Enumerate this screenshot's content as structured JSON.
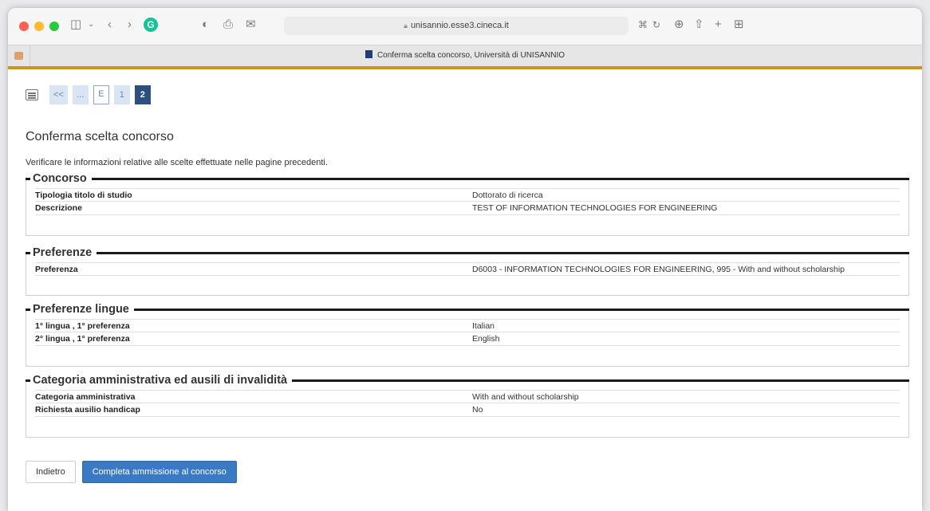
{
  "browser": {
    "url": "unisannio.esse3.cineca.it",
    "tab_title": "Conferma scelta concorso, Università di UNISANNIO",
    "grammarly_letter": "G"
  },
  "steps": {
    "items": [
      "<<",
      "...",
      "E",
      "1",
      "2"
    ]
  },
  "page": {
    "title": "Conferma scelta concorso",
    "intro": "Verificare le informazioni relative alle scelte effettuate nelle pagine precedenti."
  },
  "sections": [
    {
      "title": "Concorso",
      "rows": [
        {
          "label": "Tipologia titolo di studio",
          "value": "Dottorato di ricerca"
        },
        {
          "label": "Descrizione",
          "value": "TEST OF INFORMATION TECHNOLOGIES FOR ENGINEERING"
        }
      ]
    },
    {
      "title": "Preferenze",
      "rows": [
        {
          "label": "Preferenza",
          "value": "D6003 - INFORMATION TECHNOLOGIES FOR ENGINEERING, 995 - With and without scholarship"
        }
      ]
    },
    {
      "title": "Preferenze lingue",
      "rows": [
        {
          "label": "1° lingua , 1° preferenza",
          "value": "Italian"
        },
        {
          "label": "2° lingua , 1° preferenza",
          "value": "English"
        }
      ]
    },
    {
      "title": "Categoria amministrativa ed ausili di invalidità",
      "rows": [
        {
          "label": "Categoria amministrativa",
          "value": "With and without scholarship"
        },
        {
          "label": "Richiesta ausilio handicap",
          "value": "No"
        }
      ]
    }
  ],
  "actions": {
    "back_label": "Indietro",
    "submit_label": "Completa ammissione al concorso"
  },
  "colors": {
    "accent": "#c9961f",
    "primary": "#3a79c4",
    "active_step": "#2c4f80"
  }
}
